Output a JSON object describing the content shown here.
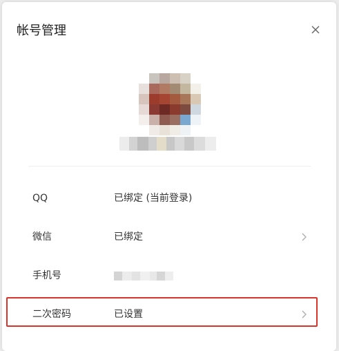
{
  "dialog": {
    "title": "帐号管理",
    "close_icon": "close-icon"
  },
  "profile": {
    "avatar": "blurred-avatar",
    "username_hidden": true
  },
  "rows": [
    {
      "label": "QQ",
      "value": "已绑定 (当前登录)",
      "has_chevron": false
    },
    {
      "label": "微信",
      "value": "已绑定",
      "has_chevron": true
    },
    {
      "label": "手机号",
      "value": "",
      "value_hidden": true,
      "has_chevron": false
    },
    {
      "label": "二次密码",
      "value": "已设置",
      "has_chevron": true
    }
  ],
  "highlight_color": "#d9332c"
}
